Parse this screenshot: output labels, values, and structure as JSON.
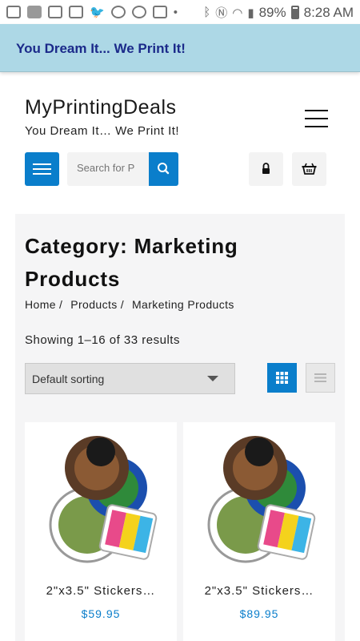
{
  "status_bar": {
    "battery": "89%",
    "time": "8:28 AM"
  },
  "banner": {
    "text": "You Dream It... We Print It!"
  },
  "header": {
    "site_title": "MyPrintingDeals",
    "tagline": "You Dream It… We Print It!"
  },
  "search": {
    "placeholder": "Search for P"
  },
  "page": {
    "title": "Category: Marketing Products",
    "breadcrumb": [
      "Home",
      "Products",
      "Marketing Products"
    ],
    "breadcrumb_sep": "/",
    "result_count": "Showing 1–16 of 33 results",
    "sort_selected": "Default sorting"
  },
  "products": [
    {
      "name": "2\"x3.5\" Stickers…",
      "price": "$59.95"
    },
    {
      "name": "2\"x3.5\" Stickers…",
      "price": "$89.95"
    }
  ],
  "colors": {
    "accent": "#0a7ecb",
    "banner_bg": "#add8e6",
    "banner_text": "#1b2a8a"
  }
}
